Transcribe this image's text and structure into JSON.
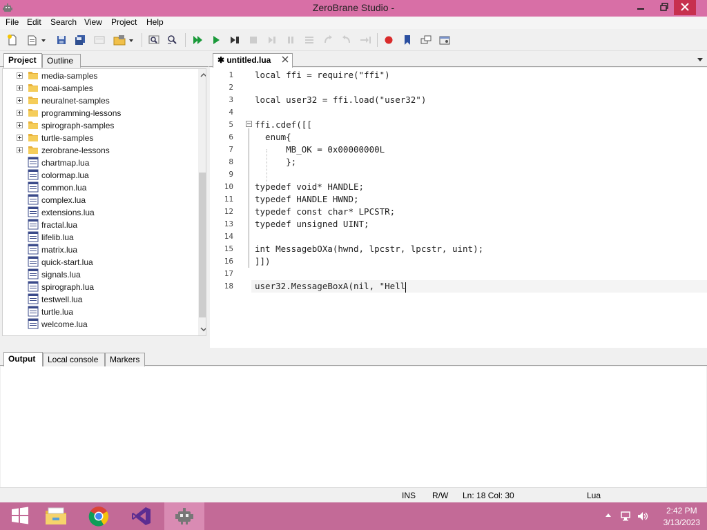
{
  "window": {
    "title": "ZeroBrane Studio -"
  },
  "menu": [
    "File",
    "Edit",
    "Search",
    "View",
    "Project",
    "Help"
  ],
  "left_panel": {
    "tabs": [
      "Project",
      "Outline"
    ],
    "active_tab": "Project",
    "tree": [
      {
        "type": "folder",
        "label": "media-samples"
      },
      {
        "type": "folder",
        "label": "moai-samples"
      },
      {
        "type": "folder",
        "label": "neuralnet-samples"
      },
      {
        "type": "folder",
        "label": "programming-lessons"
      },
      {
        "type": "folder",
        "label": "spirograph-samples"
      },
      {
        "type": "folder",
        "label": "turtle-samples"
      },
      {
        "type": "folder",
        "label": "zerobrane-lessons"
      },
      {
        "type": "file",
        "label": "chartmap.lua"
      },
      {
        "type": "file",
        "label": "colormap.lua"
      },
      {
        "type": "file",
        "label": "common.lua"
      },
      {
        "type": "file",
        "label": "complex.lua"
      },
      {
        "type": "file",
        "label": "extensions.lua"
      },
      {
        "type": "file",
        "label": "fractal.lua"
      },
      {
        "type": "file",
        "label": "lifelib.lua"
      },
      {
        "type": "file",
        "label": "matrix.lua"
      },
      {
        "type": "file",
        "label": "quick-start.lua"
      },
      {
        "type": "file",
        "label": "signals.lua"
      },
      {
        "type": "file",
        "label": "spirograph.lua"
      },
      {
        "type": "file",
        "label": "testwell.lua"
      },
      {
        "type": "file",
        "label": "turtle.lua"
      },
      {
        "type": "file",
        "label": "welcome.lua"
      }
    ]
  },
  "editor": {
    "tab_label": "untitled.lua",
    "modified_marker": "✱",
    "lines": [
      {
        "n": "1",
        "text": "local ffi = require(\"ffi\")"
      },
      {
        "n": "2",
        "text": ""
      },
      {
        "n": "3",
        "text": "local user32 = ffi.load(\"user32\")"
      },
      {
        "n": "4",
        "text": ""
      },
      {
        "n": "5",
        "text": "ffi.cdef([["
      },
      {
        "n": "6",
        "text": "  enum{"
      },
      {
        "n": "7",
        "text": "      MB_OK = 0x00000000L"
      },
      {
        "n": "8",
        "text": "      };"
      },
      {
        "n": "9",
        "text": ""
      },
      {
        "n": "10",
        "text": "typedef void* HANDLE;"
      },
      {
        "n": "11",
        "text": "typedef HANDLE HWND;"
      },
      {
        "n": "12",
        "text": "typedef const char* LPCSTR;"
      },
      {
        "n": "13",
        "text": "typedef unsigned UINT;"
      },
      {
        "n": "14",
        "text": ""
      },
      {
        "n": "15",
        "text": "int MessagebOXa(hwnd, lpcstr, lpcstr, uint);"
      },
      {
        "n": "16",
        "text": "]])"
      },
      {
        "n": "17",
        "text": ""
      },
      {
        "n": "18",
        "text": "user32.MessageBoxA(nil, \"Hell"
      }
    ]
  },
  "bottom_panel": {
    "tabs": [
      "Output",
      "Local console",
      "Markers"
    ],
    "active_tab": "Output"
  },
  "status": {
    "mode": "INS",
    "access": "R/W",
    "position": "Ln: 18 Col: 30",
    "language": "Lua"
  },
  "taskbar": {
    "apps": [
      "windows-start-icon",
      "file-explorer-icon",
      "chrome-icon",
      "visual-studio-icon",
      "zerobrane-icon"
    ],
    "time": "2:42 PM",
    "date": "3/13/2023"
  },
  "colors": {
    "titlebar": "#d86fa6",
    "taskbar": "#c36a97",
    "close_button": "#c7304e"
  }
}
